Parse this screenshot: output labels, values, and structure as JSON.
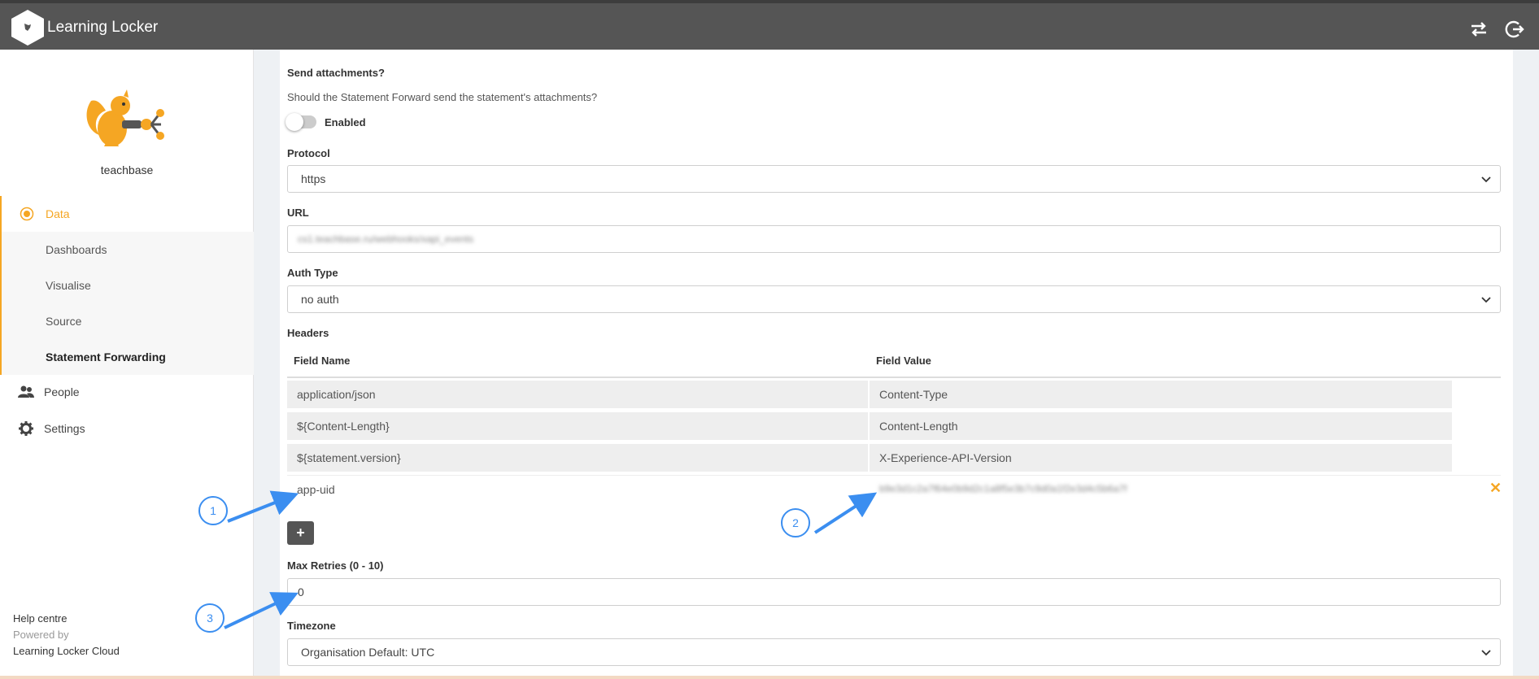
{
  "app": {
    "title": "Learning Locker"
  },
  "sidebar": {
    "org_name": "teachbase",
    "data_label": "Data",
    "sub_items": [
      {
        "label": "Dashboards"
      },
      {
        "label": "Visualise"
      },
      {
        "label": "Source"
      },
      {
        "label": "Statement Forwarding"
      }
    ],
    "people_label": "People",
    "settings_label": "Settings",
    "help_centre": "Help centre",
    "powered_by": "Powered by",
    "powered_by_name": "Learning Locker Cloud"
  },
  "form": {
    "send_attachments_label": "Send attachments?",
    "send_attachments_help": "Should the Statement Forward send the statement's attachments?",
    "enabled_label": "Enabled",
    "protocol_label": "Protocol",
    "protocol_value": "https",
    "url_label": "URL",
    "url_value": "cs1.teachbase.ru/webhooks/xapi_events",
    "auth_type_label": "Auth Type",
    "auth_type_value": "no auth",
    "headers_label": "Headers",
    "field_name_header": "Field Name",
    "field_value_header": "Field Value",
    "header_rows": [
      {
        "name": "application/json",
        "value": "Content-Type"
      },
      {
        "name": "${Content-Length}",
        "value": "Content-Length"
      },
      {
        "name": "${statement.version}",
        "value": "X-Experience-API-Version"
      }
    ],
    "edit_row": {
      "name": "app-uid",
      "value": "b9e3d1c2a7f64e0b9d2c1a8f5e3b7c9d0a1f2e3d4c5b6a7f"
    },
    "add_button": "+",
    "remove_icon": "✕",
    "max_retries_label": "Max Retries (0 - 10)",
    "max_retries_value": "0",
    "timezone_label": "Timezone",
    "timezone_value": "Organisation Default: UTC"
  },
  "callouts": [
    "1",
    "2",
    "3"
  ],
  "colors": {
    "accent": "#f5a623",
    "topbar": "#555555",
    "callout": "#3b8ef0"
  }
}
